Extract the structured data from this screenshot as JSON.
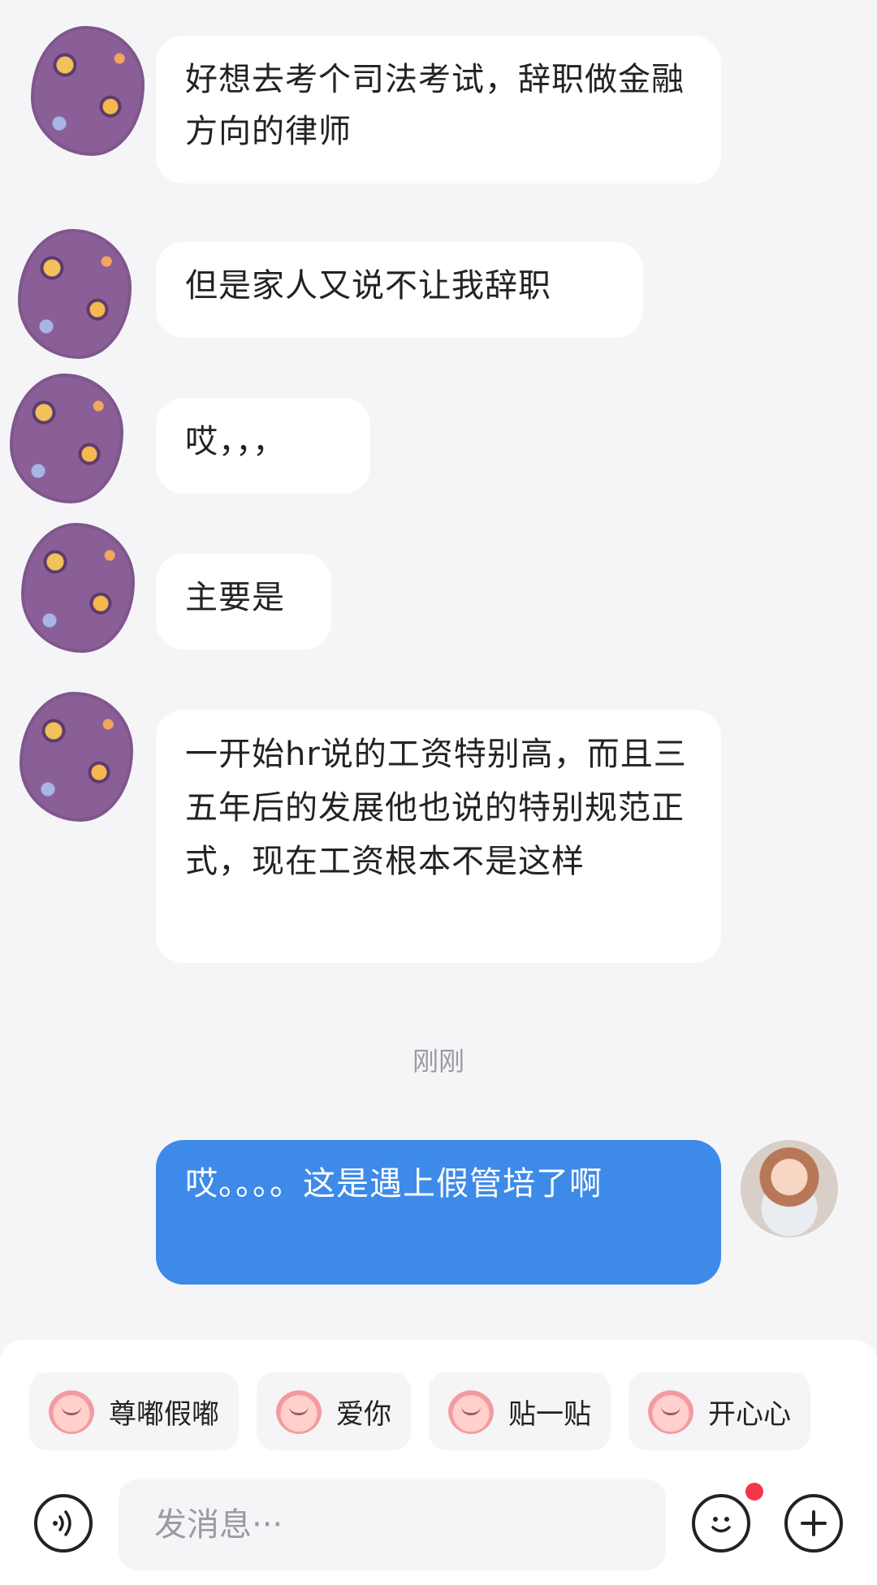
{
  "messages": [
    {
      "side": "left",
      "text": "好想去考个司法考试，辞职做金融方向的律师"
    },
    {
      "side": "left",
      "text": "但是家人又说不让我辞职"
    },
    {
      "side": "left",
      "text": "哎，，，"
    },
    {
      "side": "left",
      "text": "主要是"
    },
    {
      "side": "left",
      "text": "一开始hr说的工资特别高，而且三五年后的发展他也说的特别规范正式，现在工资根本不是这样"
    },
    {
      "side": "right",
      "text": "哎。。。。这是遇上假管培了啊"
    }
  ],
  "timestamp": "刚刚",
  "quick_replies": [
    "尊嘟假嘟",
    "爱你",
    "贴一贴",
    "开心心"
  ],
  "input": {
    "placeholder": "发消息···"
  },
  "icons": {
    "voice": "voice-icon",
    "emoji": "emoji-icon",
    "plus": "plus-icon"
  },
  "colors": {
    "my_bubble": "#3d8ae8",
    "other_bubble": "#ffffff",
    "background": "#f5f5f7",
    "notification_dot": "#f2374a"
  }
}
